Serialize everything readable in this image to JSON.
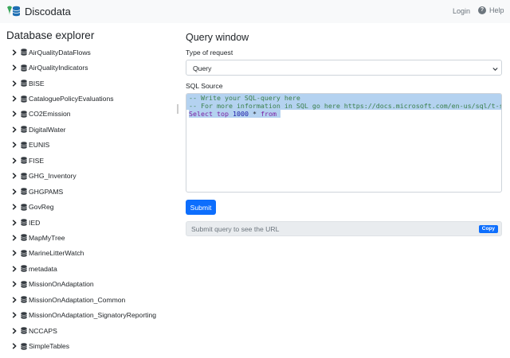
{
  "navbar": {
    "brand": "Discodata",
    "login": "Login",
    "help": "Help",
    "colors": {
      "logo_green": "#3aa65a",
      "logo_blue": "#1f6fb3",
      "primary": "#0d6efd"
    }
  },
  "sidebar": {
    "title": "Database explorer",
    "items": [
      {
        "label": "AirQualityDataFlows"
      },
      {
        "label": "AirQualityIndicators"
      },
      {
        "label": "BISE"
      },
      {
        "label": "CataloguePolicyEvaluations"
      },
      {
        "label": "CO2Emission"
      },
      {
        "label": "DigitalWater"
      },
      {
        "label": "EUNIS"
      },
      {
        "label": "FISE"
      },
      {
        "label": "GHG_Inventory"
      },
      {
        "label": "GHGPAMS"
      },
      {
        "label": "GovReg"
      },
      {
        "label": "IED"
      },
      {
        "label": "MapMyTree"
      },
      {
        "label": "MarineLitterWatch"
      },
      {
        "label": "metadata"
      },
      {
        "label": "MissionOnAdaptation"
      },
      {
        "label": "MissionOnAdaptation_Common"
      },
      {
        "label": "MissionOnAdaptation_SignatoryReporting"
      },
      {
        "label": "NCCAPS"
      },
      {
        "label": "SimpleTables"
      }
    ]
  },
  "query": {
    "title": "Query window",
    "type_label": "Type of request",
    "type_value": "Query",
    "source_label": "SQL Source",
    "code_lines": {
      "line1": "-- Write your SQL-query here",
      "line2": "-- For more information in SQL go here https://docs.microsoft.com/en-us/sql/t-sql/",
      "line3_kw1": "Select",
      "line3_kw2": "top",
      "line3_num": "1000",
      "line3_star": "*",
      "line3_kw3": "from"
    },
    "submit_label": "Submit",
    "url_placeholder": "Submit query to see the URL",
    "copy_label": "Copy"
  }
}
